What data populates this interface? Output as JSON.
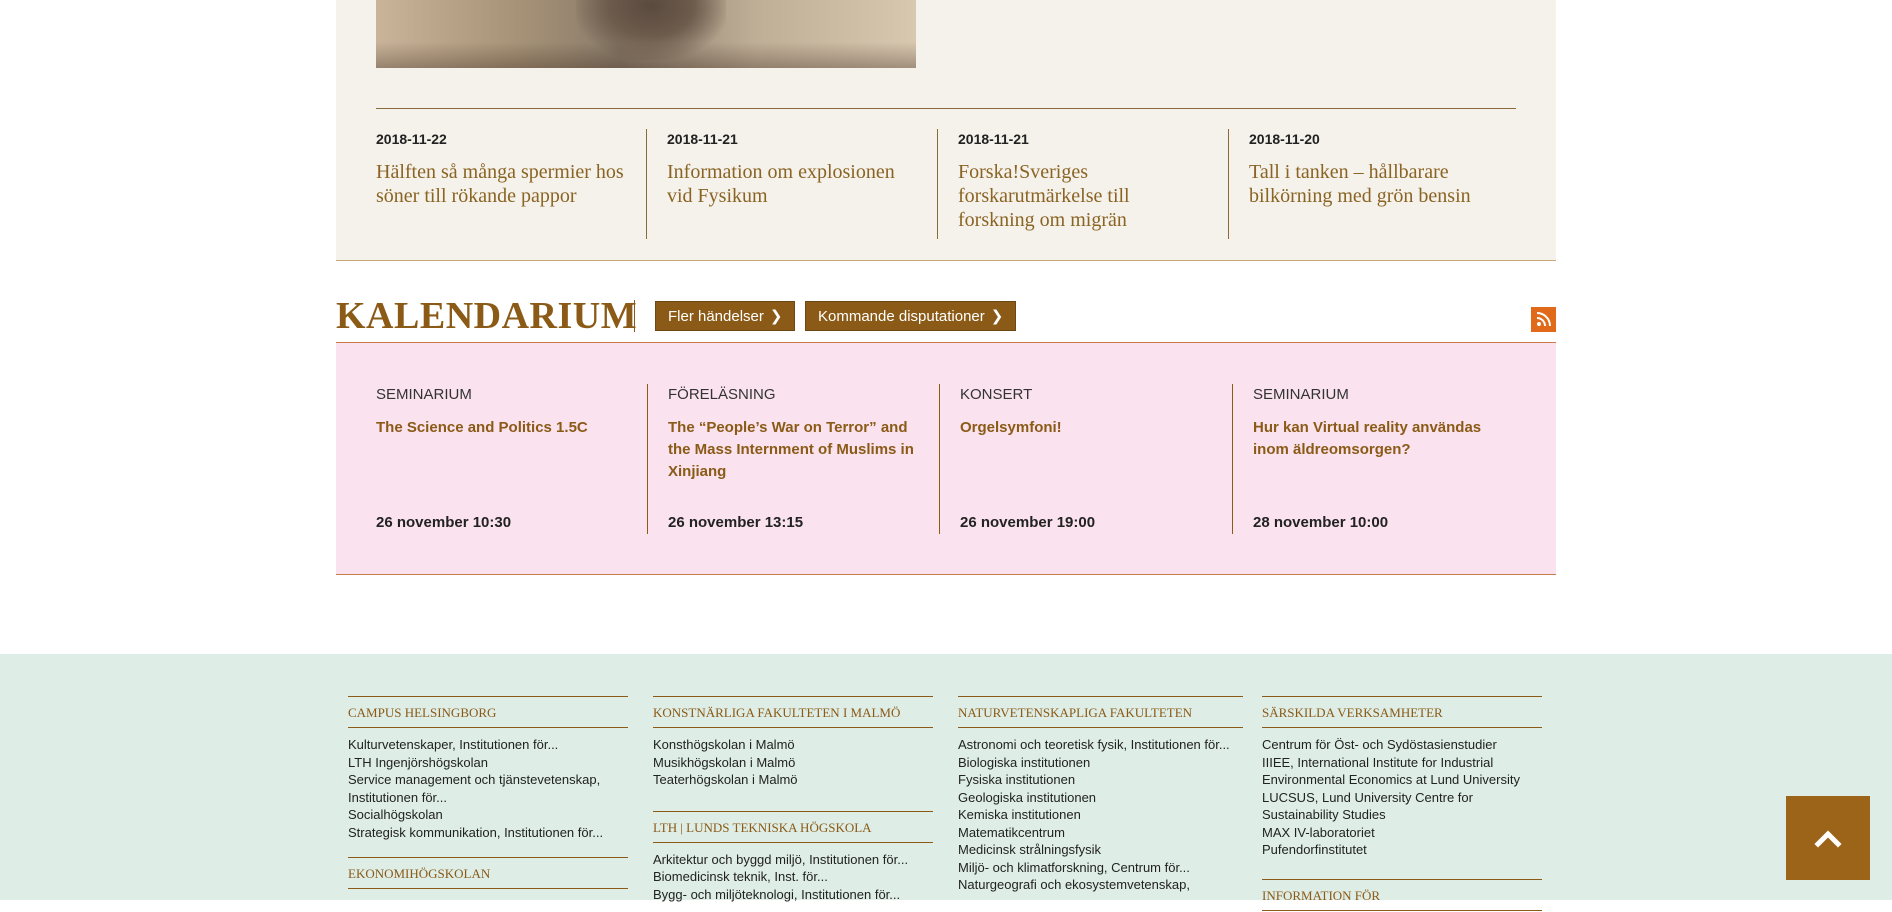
{
  "news": {
    "items": [
      {
        "date": "2018-11-22",
        "title": "Hälften så många spermier hos söner till rökande pappor"
      },
      {
        "date": "2018-11-21",
        "title": "Information om explosionen vid Fysikum"
      },
      {
        "date": "2018-11-21",
        "title": "Forska!Sveriges forskarutmärkelse till forskning om migrän"
      },
      {
        "date": "2018-11-20",
        "title": "Tall i tanken – hållbarare bilkörning med grön bensin"
      }
    ]
  },
  "calendar": {
    "title": "KALENDARIUM",
    "more_events_label": "Fler händelser",
    "disputations_label": "Kommande disputationer",
    "events": [
      {
        "type": "SEMINARIUM",
        "name": "The Science and Politics 1.5C",
        "time": "26 november 10:30"
      },
      {
        "type": "FÖRELÄSNING",
        "name": "The “People’s War on Terror” and the Mass Internment of Muslims in Xinjiang",
        "time": "26 november 13:15"
      },
      {
        "type": "KONSERT",
        "name": "Orgelsymfoni!",
        "time": "26 november 19:00"
      },
      {
        "type": "SEMINARIUM",
        "name": "Hur kan Virtual reality användas inom äldreomsorgen?",
        "time": "28 november 10:00"
      }
    ]
  },
  "footer": {
    "col1": {
      "head1": "CAMPUS HELSINGBORG",
      "items1": [
        "Kulturvetenskaper, Institutionen för...",
        "LTH Ingenjörshögskolan",
        "Service management och tjänstevetenskap, Institutionen för...",
        "Socialhögskolan",
        "Strategisk kommunikation, Institutionen för..."
      ],
      "head2": "EKONOMIHÖGSKOLAN"
    },
    "col2": {
      "head1": "KONSTNÄRLIGA FAKULTETEN I MALMÖ",
      "items1": [
        "Konsthögskolan i Malmö",
        "Musikhögskolan i Malmö",
        "Teaterhögskolan i Malmö"
      ],
      "head2": "LTH | LUNDS TEKNISKA HÖGSKOLA",
      "items2": [
        "Arkitektur och byggd miljö, Institutionen för...",
        "Biomedicinsk teknik, Inst. för...",
        "Bygg- och miljöteknologi, Institutionen för..."
      ]
    },
    "col3": {
      "head1": "NATURVETENSKAPLIGA FAKULTETEN",
      "items1": [
        "Astronomi och teoretisk fysik, Institutionen för...",
        "Biologiska institutionen",
        "Fysiska institutionen",
        "Geologiska institutionen",
        "Kemiska institutionen",
        "Matematikcentrum",
        "Medicinsk strålningsfysik",
        "Miljö- och klimatforskning, Centrum för...",
        "Naturgeografi och ekosystemvetenskap,"
      ]
    },
    "col4": {
      "head1": "SÄRSKILDA VERKSAMHETER",
      "items1": [
        "Centrum för Öst- och Sydöstasienstudier",
        "IIIEE, International Institute for Industrial Environmental Economics at Lund University",
        "LUCSUS, Lund University Centre for Sustainability Studies",
        "MAX IV-laboratoriet",
        "Pufendorfinstitutet"
      ],
      "head2": "INFORMATION FÖR"
    }
  },
  "icons": {
    "rss": "rss-icon",
    "back_to_top": "arrow-up-icon",
    "chevron": "chevron-right-icon"
  },
  "colors": {
    "accent": "#8a5a16",
    "calendar_bg": "#fae3ef",
    "news_bg": "#f5f1eb",
    "footer_bg": "#deede6",
    "rss": "#e06a1a"
  }
}
